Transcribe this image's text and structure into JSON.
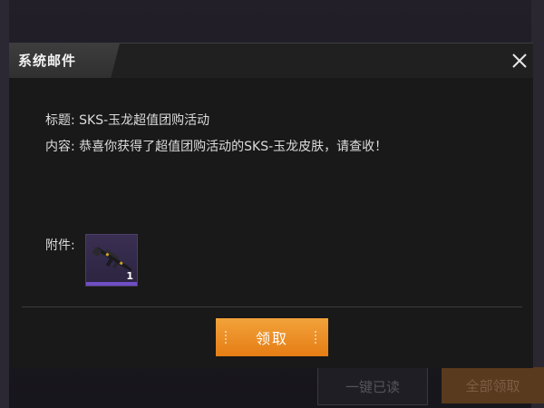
{
  "dialog": {
    "title": "系统邮件",
    "close_icon": "close-icon"
  },
  "mail": {
    "title_label": "标题:",
    "title_value": "SKS-玉龙超值团购活动",
    "content_label": "内容:",
    "content_value": "恭喜你获得了超值团购活动的SKS-玉龙皮肤，请查收！",
    "attachment_label": "附件:",
    "attachment": {
      "icon": "rifle-icon",
      "count": "1",
      "rarity_color": "#6f4fc4"
    }
  },
  "actions": {
    "claim_label": "领取"
  },
  "background": {
    "mark_read_label": "一键已读",
    "claim_all_label": "全部领取"
  },
  "colors": {
    "accent": "#e57d14",
    "rarity": "#6f4fc4"
  }
}
